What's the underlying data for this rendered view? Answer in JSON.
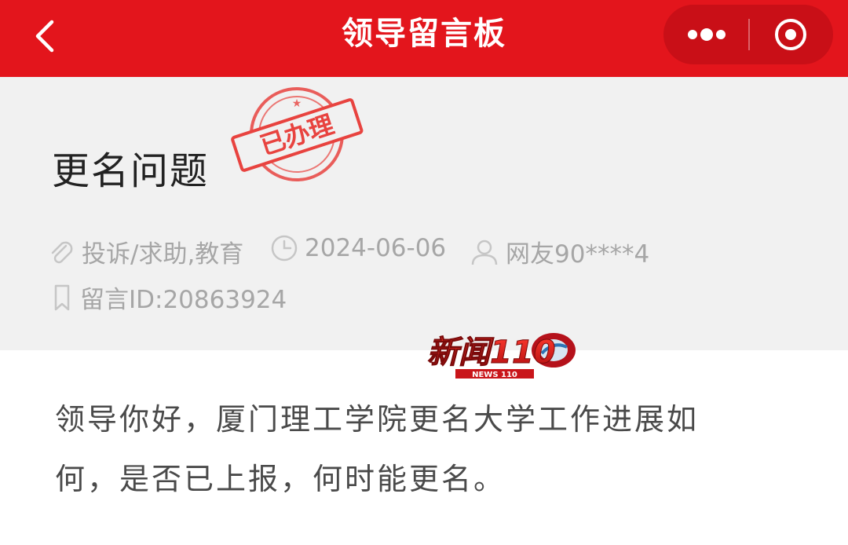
{
  "nav": {
    "title": "领导留言板"
  },
  "post": {
    "title": "更名问题",
    "stamp_text": "已办理",
    "category": "投诉/求助,教育",
    "date": "2024-06-06",
    "user": "网友90****4",
    "message_id": "留言ID:20863924",
    "content": "领导你好，厦门理工学院更名大学工作进展如何，是否已上报，何时能更名。"
  },
  "watermark": {
    "logo_text": "新闻110",
    "logo_sub": "NEWS 110"
  },
  "colors": {
    "brand_red": "#e3151c",
    "meta_gray": "#a6a6a6"
  }
}
